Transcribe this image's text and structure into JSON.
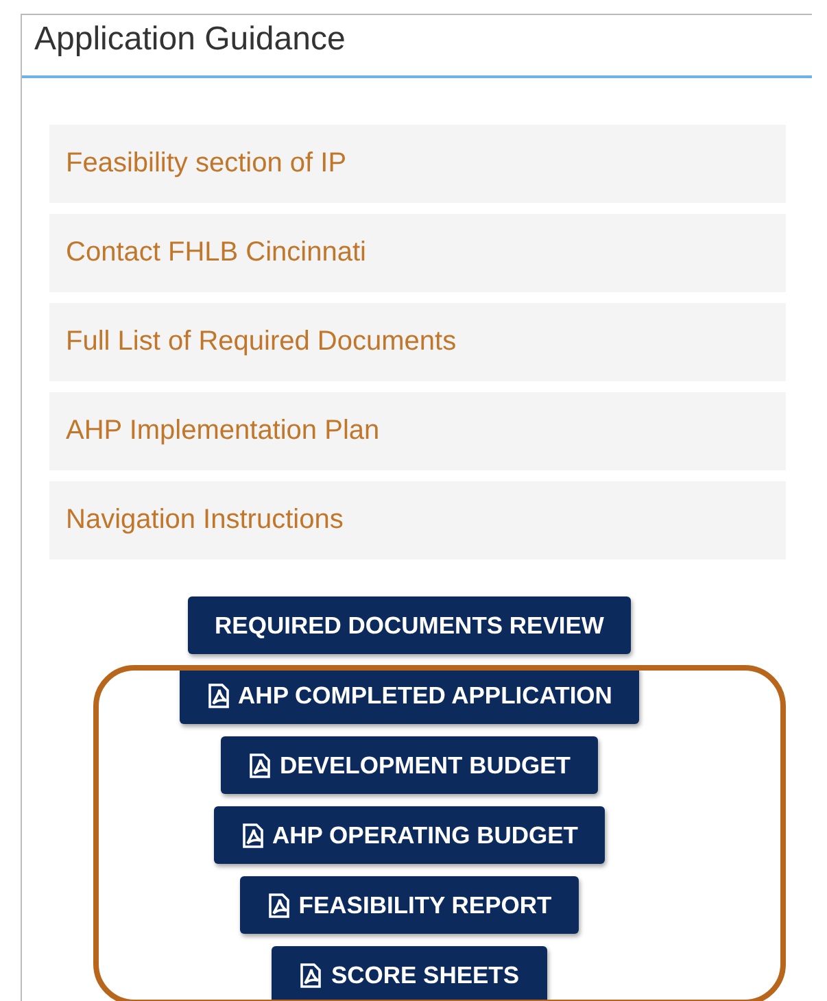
{
  "panel": {
    "title": "Application Guidance"
  },
  "links": [
    {
      "label": "Feasibility section of IP"
    },
    {
      "label": "Contact FHLB Cincinnati"
    },
    {
      "label": "Full List of Required Documents"
    },
    {
      "label": "AHP Implementation Plan"
    },
    {
      "label": "Navigation Instructions"
    }
  ],
  "buttons": [
    {
      "label": "REQUIRED DOCUMENTS REVIEW",
      "kind": "plain"
    },
    {
      "label": "AHP COMPLETED APPLICATION",
      "kind": "pdf"
    },
    {
      "label": "DEVELOPMENT BUDGET",
      "kind": "pdf"
    },
    {
      "label": "AHP OPERATING BUDGET",
      "kind": "pdf"
    },
    {
      "label": "FEASIBILITY REPORT",
      "kind": "pdf"
    },
    {
      "label": "SCORE SHEETS",
      "kind": "pdf"
    }
  ]
}
